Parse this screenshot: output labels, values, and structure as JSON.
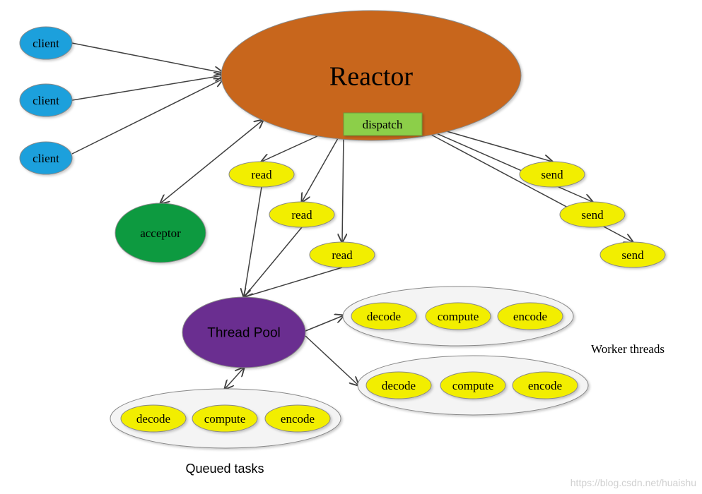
{
  "colors": {
    "client": "#1aa0dc",
    "reactor": "#c8661a",
    "dispatch": "#8ccf4a",
    "acceptor": "#0a9a40",
    "task": "#f2ee00",
    "thread_pool": "#6a2d90",
    "group": "#f4f4f4",
    "arrow": "#404040"
  },
  "nodes": {
    "clients": [
      "client",
      "client",
      "client"
    ],
    "reactor": "Reactor",
    "dispatch": "dispatch",
    "acceptor": "acceptor",
    "reads": [
      "read",
      "read",
      "read"
    ],
    "sends": [
      "send",
      "send",
      "send"
    ],
    "thread_pool": "Thread Pool",
    "worker_groups": [
      [
        "decode",
        "compute",
        "encode"
      ],
      [
        "decode",
        "compute",
        "encode"
      ]
    ],
    "queue_group": [
      "decode",
      "compute",
      "encode"
    ]
  },
  "labels": {
    "worker_threads": "Worker threads",
    "queued_tasks": "Queued tasks",
    "watermark": "https://blog.csdn.net/huaishu"
  }
}
